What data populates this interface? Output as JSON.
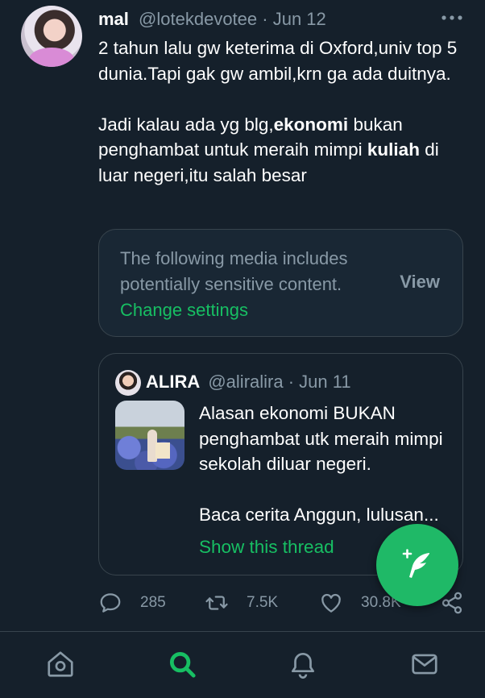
{
  "tweet": {
    "display_name": "mal",
    "handle": "@lotekdevotee",
    "date": "Jun 12",
    "separator": " · ",
    "more_icon": "more-horizontal-icon",
    "lines": {
      "p1": "2 tahun lalu gw keterima di Oxford,univ top 5 dunia.Tapi gak gw ambil,krn ga ada duitnya.",
      "p2_a": "Jadi kalau ada yg blg,",
      "p2_b": "ekonomi",
      "p2_c": " bukan penghambat untuk meraih mimpi ",
      "p2_d": "kuliah",
      "p2_e": " di luar negeri,itu salah besar"
    }
  },
  "sensitive_media": {
    "message": "The following media includes potentially sensitive content.",
    "change_settings": "Change settings",
    "view": "View"
  },
  "quoted_tweet": {
    "display_name": "ALIRA",
    "handle": "@aliralira",
    "date": "Jun 11",
    "separator": " · ",
    "text_p1": "Alasan ekonomi BUKAN penghambat utk meraih mimpi sekolah diluar negeri.",
    "text_p2": "Baca cerita Anggun, lulusan...",
    "show_thread": "Show this thread"
  },
  "actions": {
    "reply_count": "285",
    "retweet_count": "7.5K",
    "like_count": "30.8K"
  },
  "nav": {
    "items": [
      "home-icon",
      "search-icon",
      "notifications-icon",
      "messages-icon"
    ],
    "active": "search-icon"
  },
  "colors": {
    "background": "#15202b",
    "accent": "#17bf63",
    "muted": "#8899a6",
    "border": "#38444d"
  }
}
